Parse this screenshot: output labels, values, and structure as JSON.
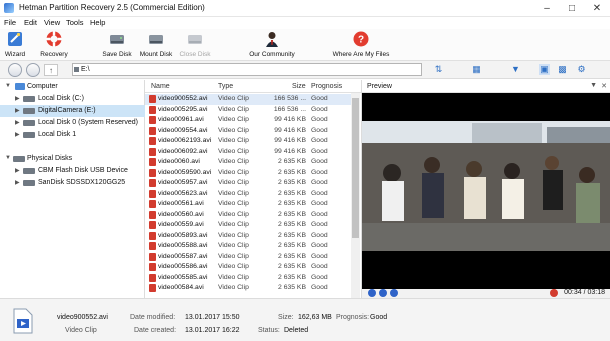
{
  "window": {
    "title": "Hetman Partition Recovery 2.5 (Commercial Edition)"
  },
  "menu": [
    "File",
    "Edit",
    "View",
    "Tools",
    "Help"
  ],
  "toolbar": {
    "wizard": "Wizard",
    "recovery": "Recovery",
    "save_disk": "Save Disk",
    "mount_disk": "Mount Disk",
    "close_disk": "Close Disk",
    "our_community": "Our Community",
    "where_are_my_files": "Where Are My Files"
  },
  "address": {
    "path": "E:\\"
  },
  "tree": {
    "computer": "Computer",
    "disks": [
      "Local Disk (C:)",
      "DigitalCamera (E:)",
      "Local Disk 0 (System Reserved)",
      "Local Disk 1"
    ],
    "physical": "Physical Disks",
    "physical_disks": [
      "CBM Flash Disk USB Device",
      "SanDisk SDSSDX120GG25"
    ]
  },
  "filelist": {
    "columns": {
      "name": "Name",
      "type": "Type",
      "size": "Size",
      "prognosis": "Prognosis"
    },
    "rows": [
      {
        "name": "video900552.avi",
        "type": "Video Clip",
        "size": "166 536 ...",
        "prognosis": "Good"
      },
      {
        "name": "video005295.avi",
        "type": "Video Clip",
        "size": "166 536 ...",
        "prognosis": "Good"
      },
      {
        "name": "video00961.avi",
        "type": "Video Clip",
        "size": "99 416 KB",
        "prognosis": "Good"
      },
      {
        "name": "video009554.avi",
        "type": "Video Clip",
        "size": "99 416 KB",
        "prognosis": "Good"
      },
      {
        "name": "video0062193.avi",
        "type": "Video Clip",
        "size": "99 416 KB",
        "prognosis": "Good"
      },
      {
        "name": "video006092.avi",
        "type": "Video Clip",
        "size": "99 416 KB",
        "prognosis": "Good"
      },
      {
        "name": "video0060.avi",
        "type": "Video Clip",
        "size": "2 635 KB",
        "prognosis": "Good"
      },
      {
        "name": "video0059590.avi",
        "type": "Video Clip",
        "size": "2 635 KB",
        "prognosis": "Good"
      },
      {
        "name": "video005957.avi",
        "type": "Video Clip",
        "size": "2 635 KB",
        "prognosis": "Good"
      },
      {
        "name": "video005623.avi",
        "type": "Video Clip",
        "size": "2 635 KB",
        "prognosis": "Good"
      },
      {
        "name": "video00561.avi",
        "type": "Video Clip",
        "size": "2 635 KB",
        "prognosis": "Good"
      },
      {
        "name": "video00560.avi",
        "type": "Video Clip",
        "size": "2 635 KB",
        "prognosis": "Good"
      },
      {
        "name": "video00559.avi",
        "type": "Video Clip",
        "size": "2 635 KB",
        "prognosis": "Good"
      },
      {
        "name": "video005893.avi",
        "type": "Video Clip",
        "size": "2 635 KB",
        "prognosis": "Good"
      },
      {
        "name": "video005588.avi",
        "type": "Video Clip",
        "size": "2 635 KB",
        "prognosis": "Good"
      },
      {
        "name": "video005587.avi",
        "type": "Video Clip",
        "size": "2 635 KB",
        "prognosis": "Good"
      },
      {
        "name": "video005586.avi",
        "type": "Video Clip",
        "size": "2 635 KB",
        "prognosis": "Good"
      },
      {
        "name": "video005585.avi",
        "type": "Video Clip",
        "size": "2 635 KB",
        "prognosis": "Good"
      },
      {
        "name": "video00584.avi",
        "type": "Video Clip",
        "size": "2 635 KB",
        "prognosis": "Good"
      }
    ]
  },
  "preview": {
    "title": "Preview",
    "time": "00:34 / 03:18"
  },
  "status": {
    "file_name": "video900552.avi",
    "file_type": "Video Clip",
    "modified_label": "Date modified:",
    "modified_value": "13.01.2017 15:50",
    "created_label": "Date created:",
    "created_value": "13.01.2017 16:22",
    "size_label": "Size:",
    "size_value": "162,63 MB",
    "status_label": "Status:",
    "status_value": "Deleted",
    "prognosis_label": "Prognosis:",
    "prognosis_value": "Good"
  },
  "colors": {
    "selection": "#cce4f7",
    "accent": "#2f63c8",
    "status_deleted": "#111111"
  },
  "icons": [
    "wizard-icon",
    "recovery-lifebuoy-icon",
    "save-disk-icon",
    "mount-disk-icon",
    "close-disk-icon",
    "community-icon",
    "where-files-icon"
  ]
}
